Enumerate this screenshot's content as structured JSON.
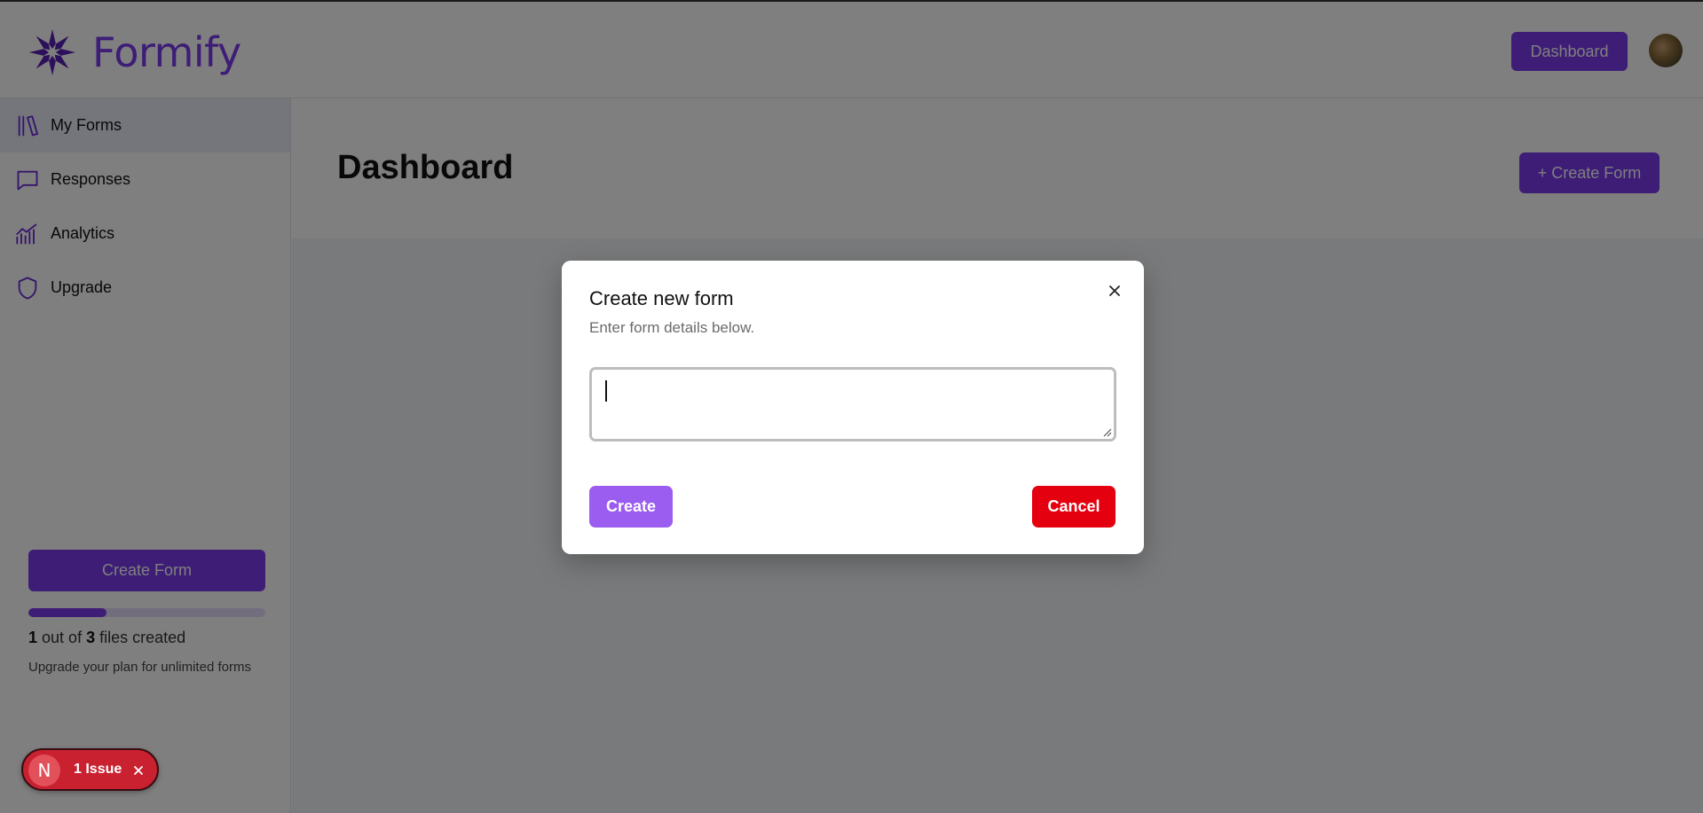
{
  "app": {
    "name": "Formify"
  },
  "header": {
    "dashboard_button": "Dashboard",
    "avatar_icon": "user-avatar"
  },
  "sidebar": {
    "items": [
      {
        "label": "My Forms",
        "icon": "library-icon",
        "active": true
      },
      {
        "label": "Responses",
        "icon": "message-square-icon",
        "active": false
      },
      {
        "label": "Analytics",
        "icon": "chart-icon",
        "active": false
      },
      {
        "label": "Upgrade",
        "icon": "shield-icon",
        "active": false
      }
    ],
    "create_button": "Create Form",
    "usage": {
      "used": "1",
      "text_mid": "out of",
      "total": "3",
      "text_end": "files created",
      "progress": 0.33
    },
    "upgrade_hint": "Upgrade your plan for unlimited forms"
  },
  "main": {
    "title": "Dashboard",
    "create_button": "+ Create Form"
  },
  "dialog": {
    "title": "Create new form",
    "subtitle": "Enter form details below.",
    "textarea_value": "",
    "create_button": "Create",
    "cancel_button": "Cancel"
  },
  "issue_badge": {
    "letter": "N",
    "label": "1 Issue"
  },
  "colors": {
    "brand": "#7c3aed",
    "danger": "#e5000f",
    "overlay": "rgba(0,0,0,0.5)"
  }
}
